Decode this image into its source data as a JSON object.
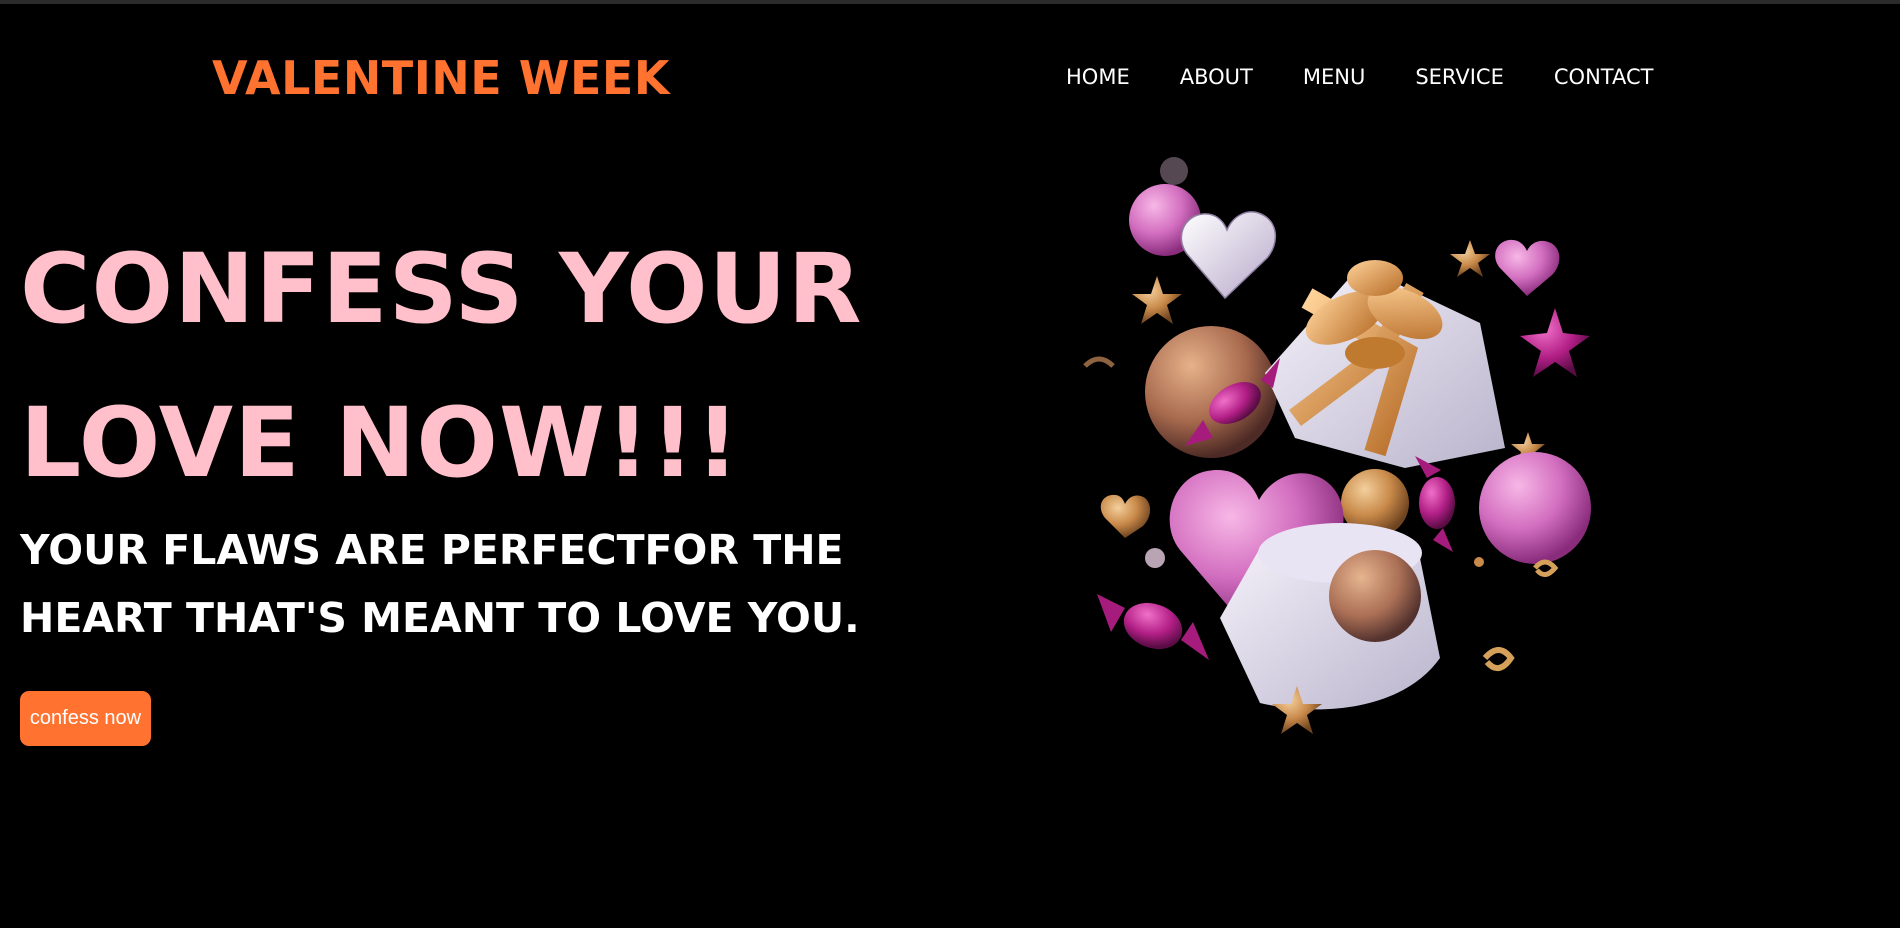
{
  "header": {
    "logo": "VALENTINE WEEK",
    "nav": [
      "HOME",
      "ABOUT",
      "MENU",
      "SERVICE",
      "CONTACT"
    ]
  },
  "hero": {
    "title_line1": "CONFESS YOUR",
    "title_line2": "LOVE NOW!!!",
    "subtitle": "YOUR FLAWS ARE PERFECTFOR THE HEART THAT'S MEANT TO LOVE YOU.",
    "cta_label": "confess now"
  },
  "colors": {
    "background": "#000000",
    "accent": "#ff7230",
    "title": "#ffc0cb",
    "text": "#ffffff"
  },
  "illustration": {
    "icon": "valentine-gift-illustration"
  }
}
